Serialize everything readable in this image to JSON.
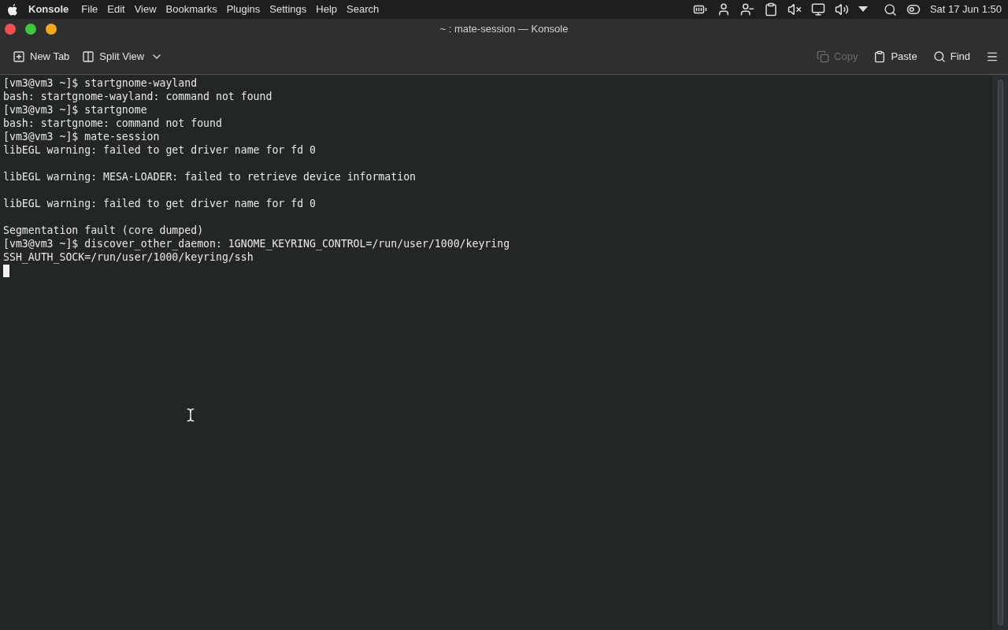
{
  "menu_bar": {
    "app_name": "Konsole",
    "menus": [
      "File",
      "Edit",
      "View",
      "Bookmarks",
      "Plugins",
      "Settings",
      "Help",
      "Search"
    ],
    "clock": "Sat 17 Jun 1:50"
  },
  "window": {
    "title": "~ : mate-session — Konsole"
  },
  "toolbar": {
    "left": [
      {
        "label": "New Tab",
        "kind": "new-tab",
        "disabled": false
      },
      {
        "label": "Split View",
        "kind": "split",
        "disabled": false
      }
    ],
    "right": [
      {
        "label": "Copy",
        "kind": "copy",
        "disabled": true
      },
      {
        "label": "Paste",
        "kind": "paste",
        "disabled": false
      },
      {
        "label": "Find",
        "kind": "find",
        "disabled": false
      }
    ]
  },
  "terminal": {
    "blocks": [
      [
        "[vm3@vm3 ~]$ startgnome-wayland",
        "bash: startgnome-wayland: command not found",
        "[vm3@vm3 ~]$ startgnome",
        "bash: startgnome: command not found",
        "[vm3@vm3 ~]$ mate-session",
        "libEGL warning: failed to get driver name for fd 0"
      ],
      [
        "libEGL warning: MESA-LOADER: failed to retrieve device information"
      ],
      [
        "libEGL warning: failed to get driver name for fd 0"
      ],
      [
        "Segmentation fault (core dumped)",
        "[vm3@vm3 ~]$ discover_other_daemon: 1GNOME_KEYRING_CONTROL=/run/user/1000/keyring",
        "SSH_AUTH_SOCK=/run/user/1000/keyring/ssh"
      ]
    ]
  }
}
